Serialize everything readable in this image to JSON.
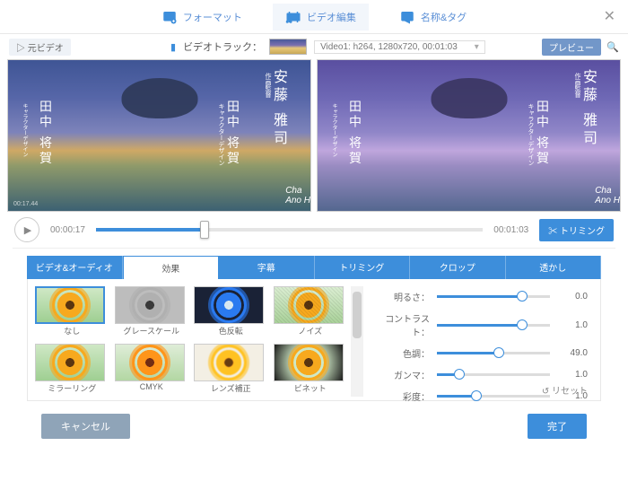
{
  "topTabs": {
    "format": "フォーマット",
    "edit": "ビデオ編集",
    "tag": "名称&タグ"
  },
  "track": {
    "orig": "元ビデオ",
    "label": "ビデオトラック：",
    "value": "Video1: h264, 1280x720, 00:01:03",
    "preview": "プレビュー"
  },
  "playbar": {
    "current": "00:00:17",
    "total": "00:01:03",
    "trim": "トリミング"
  },
  "midTabs": {
    "va": "ビデオ&オーディオ",
    "fx": "効果",
    "sub": "字幕",
    "trim": "トリミング",
    "crop": "クロップ",
    "wm": "透かし"
  },
  "effects": [
    "なし",
    "グレースケール",
    "色反転",
    "ノイズ",
    "ミラーリング",
    "CMYK",
    "レンズ補正",
    "ビネット"
  ],
  "sliders": [
    {
      "label": "明るさ：",
      "val": "0.0",
      "pct": 75
    },
    {
      "label": "コントラスト：",
      "val": "1.0",
      "pct": 75
    },
    {
      "label": "色調：",
      "val": "49.0",
      "pct": 55
    },
    {
      "label": "ガンマ：",
      "val": "1.0",
      "pct": 20
    },
    {
      "label": "彩度：",
      "val": "1.0",
      "pct": 35
    }
  ],
  "reset": "リセット",
  "footer": {
    "cancel": "キャンセル",
    "ok": "完了"
  },
  "credits": {
    "t1s": "作画監督",
    "t1": "安藤 雅司",
    "t2s": "キャラクターデザイン",
    "t2": "田中 将賀",
    "cha": "Cha",
    "ano": "Ano H"
  }
}
